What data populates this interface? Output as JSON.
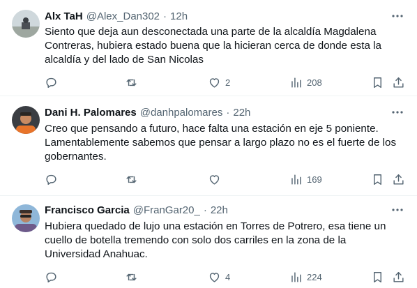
{
  "tweets": [
    {
      "name": "Alx TaH",
      "handle": "@Alex_Dan302",
      "separator": "·",
      "time": "12h",
      "lines": [
        "Siento que deja aun desconectada una parte de la alcaldía Magdalena",
        "Contreras, hubiera estado buena que la hicieran cerca de donde esta la",
        "alcaldía y del lado de San Nicolas"
      ],
      "replies": "",
      "retweets": "",
      "likes": "2",
      "views": "208"
    },
    {
      "name": "Dani H. Palomares",
      "handle": "@danhpalomares",
      "separator": "·",
      "time": "22h",
      "lines": [
        "Creo que pensando a futuro, hace falta una estación en eje 5 poniente.",
        "Lamentablemente sabemos que pensar a largo plazo no es el fuerte de los",
        "gobernantes."
      ],
      "replies": "",
      "retweets": "",
      "likes": "",
      "views": "169"
    },
    {
      "name": "Francisco Garcia",
      "handle": "@FranGar20_",
      "separator": "·",
      "time": "22h",
      "lines": [
        "Hubiera quedado de lujo una estación en Torres de Potrero, esa tiene un",
        "cuello de botella tremendo con solo dos carriles en la zona de la",
        "Universidad Anahuac."
      ],
      "replies": "",
      "retweets": "",
      "likes": "4",
      "views": "224"
    }
  ],
  "icons": {
    "more": "more-horizontal-icon",
    "reply": "reply-icon",
    "retweet": "retweet-icon",
    "like": "heart-icon",
    "views": "views-chart-icon",
    "bookmark": "bookmark-icon",
    "share": "share-icon"
  },
  "colors": {
    "text": "#0f1419",
    "secondary": "#536471",
    "divider": "#eff3f4"
  }
}
